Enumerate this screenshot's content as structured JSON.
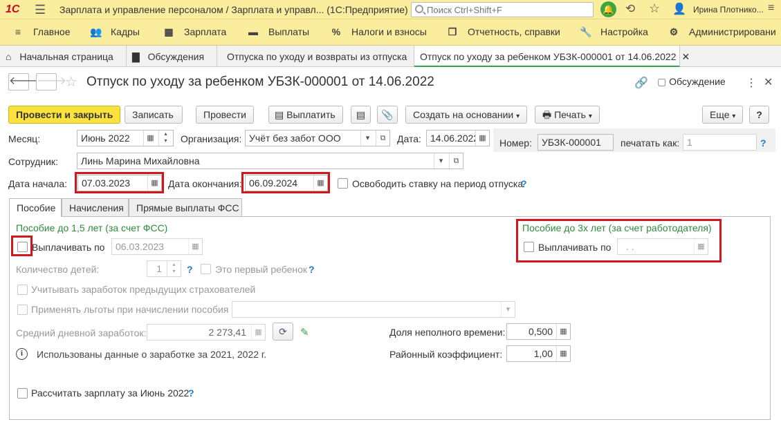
{
  "topbar": {
    "logo": "1С",
    "title": "Зарплата и управление персоналом / Зарплата и управл...  (1С:Предприятие)",
    "search_placeholder": "Поиск Ctrl+Shift+F",
    "user": "Ирина Плотнико..."
  },
  "menu": [
    "Главное",
    "Кадры",
    "Зарплата",
    "Выплаты",
    "Налоги и взносы",
    "Отчетность, справки",
    "Настройка",
    "Администрировани"
  ],
  "tabs": [
    "Начальная страница",
    "Обсуждения",
    "Отпуска по уходу и возвраты из отпуска",
    "Отпуск по уходу за ребенком УБЗК-000001 от 14.06.2022"
  ],
  "doc": {
    "title": "Отпуск по уходу за ребенком УБЗК-000001 от 14.06.2022",
    "discussion": "Обсуждение"
  },
  "toolbar": {
    "post_close": "Провести и закрыть",
    "save": "Записать",
    "post": "Провести",
    "pay": "Выплатить",
    "create_based": "Создать на основании",
    "print": "Печать",
    "more": "Еще",
    "help": "?"
  },
  "form": {
    "month_label": "Месяц:",
    "month": "Июнь 2022",
    "org_label": "Организация:",
    "org": "Учёт без забот ООО",
    "date_label": "Дата:",
    "date": "14.06.2022",
    "number_label": "Номер:",
    "number": "УБЗК-000001",
    "print_as_label": "печатать как:",
    "print_as": "1",
    "employee_label": "Сотрудник:",
    "employee": "Линь Марина Михайловна",
    "start_label": "Дата начала:",
    "start": "07.03.2023",
    "end_label": "Дата окончания:",
    "end": "06.09.2024",
    "free_rate_label": "Освободить ставку на период отпуска"
  },
  "inner_tabs": [
    "Пособие",
    "Начисления",
    "Прямые выплаты ФСС"
  ],
  "benefit": {
    "fss_heading": "Пособие до 1,5 лет (за счет ФСС)",
    "pay_until_label": "Выплачивать по",
    "pay_until": "06.03.2023",
    "children_label": "Количество детей:",
    "children": "1",
    "first_child_label": "Это первый ребенок",
    "prev_insurers_label": "Учитывать заработок предыдущих страхователей",
    "benefits_label": "Применять льготы при начислении пособия",
    "avg_label": "Средний дневной заработок:",
    "avg": "2 273,41",
    "info_text": "Использованы данные о заработке за  2021,  2022 г.",
    "recalc_label": "Рассчитать зарплату за Июнь 2022",
    "employer_heading": "Пособие до 3х лет (за счет работодателя)",
    "employer_pay_label": "Выплачивать по",
    "employer_pay": ". .",
    "part_time_label": "Доля неполного времени:",
    "part_time": "0,500",
    "regional_label": "Районный коэффициент:",
    "regional": "1,00"
  }
}
